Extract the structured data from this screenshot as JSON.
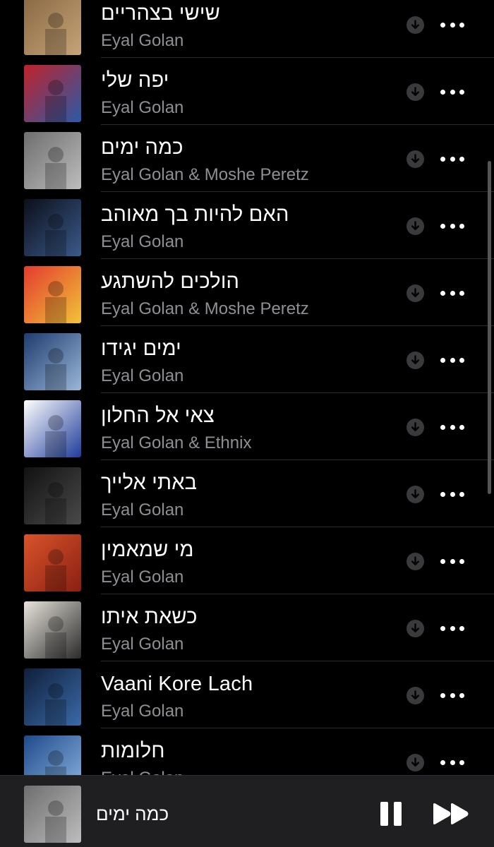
{
  "songs": [
    {
      "title": "שישי בצהריים",
      "artist": "Eyal Golan",
      "art_colors": [
        "#8a6a44",
        "#c6a478"
      ]
    },
    {
      "title": "יפה שלי",
      "artist": "Eyal Golan",
      "art_colors": [
        "#c0222a",
        "#2a5aa8"
      ]
    },
    {
      "title": "כמה ימים",
      "artist": "Eyal Golan & Moshe Peretz",
      "art_colors": [
        "#6e6e6e",
        "#bdbdbd"
      ]
    },
    {
      "title": "האם להיות בך מאוהב",
      "artist": "Eyal Golan",
      "art_colors": [
        "#0c0f1a",
        "#3a5a8a"
      ]
    },
    {
      "title": "הולכים להשתגע",
      "artist": "Eyal Golan & Moshe Peretz",
      "art_colors": [
        "#e33b2e",
        "#f3c23a"
      ]
    },
    {
      "title": "ימים יגידו",
      "artist": "Eyal Golan",
      "art_colors": [
        "#1e3c6e",
        "#9ab6d8"
      ]
    },
    {
      "title": "צאי אל החלון",
      "artist": "Eyal Golan & Ethnix",
      "art_colors": [
        "#ffffff",
        "#1f3c9a"
      ]
    },
    {
      "title": "באתי אלייך",
      "artist": "Eyal Golan",
      "art_colors": [
        "#111111",
        "#4a4a4a"
      ]
    },
    {
      "title": "מי שמאמין",
      "artist": "Eyal Golan",
      "art_colors": [
        "#d9542a",
        "#8a1f12"
      ]
    },
    {
      "title": "כשאת איתו",
      "artist": "Eyal Golan",
      "art_colors": [
        "#e8e4dc",
        "#2a2a2a"
      ]
    },
    {
      "title": "Vaani Kore Lach",
      "artist": "Eyal Golan",
      "art_colors": [
        "#0f1f3a",
        "#3a6aa8"
      ]
    },
    {
      "title": "חלומות",
      "artist": "Eyal Golan",
      "art_colors": [
        "#1f4a8a",
        "#8ab4e0"
      ]
    }
  ],
  "now_playing": {
    "title": "כמה ימים",
    "art_colors": [
      "#6e6e6e",
      "#bdbdbd"
    ]
  },
  "icons": {
    "download": "download-circle-icon",
    "more": "more-dots-icon",
    "pause": "pause-icon",
    "fast_forward": "fast-forward-icon"
  },
  "colors": {
    "background": "#000000",
    "secondary_text": "#8e8e93",
    "player_background": "#1f1f21"
  }
}
